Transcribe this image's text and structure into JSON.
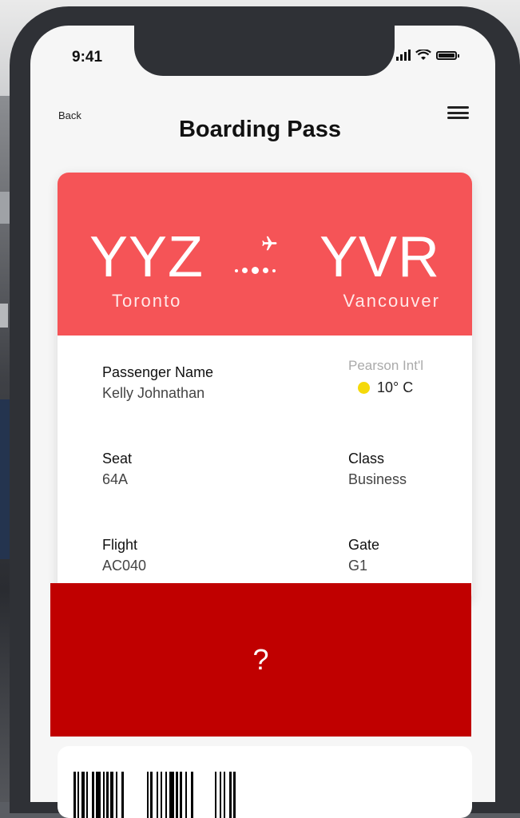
{
  "status_bar": {
    "time": "9:41"
  },
  "nav": {
    "back_label": "Back",
    "title": "Boarding Pass"
  },
  "flight_route": {
    "from_code": "YYZ",
    "from_city": "Toronto",
    "to_code": "YVR",
    "to_city": "Vancouver"
  },
  "weather": {
    "airport": "Pearson Int'l",
    "temperature": "10° C"
  },
  "details": {
    "passenger_label": "Passenger Name",
    "passenger_value": "Kelly Johnathan",
    "seat_label": "Seat",
    "seat_value": "64A",
    "class_label": "Class",
    "class_value": "Business",
    "flight_label": "Flight",
    "flight_value": "AC040",
    "gate_label": "Gate",
    "gate_value": "G1"
  },
  "redaction": {
    "text": "?"
  },
  "colors": {
    "header_red": "#f55457",
    "redaction_red": "#c00000",
    "sun_yellow": "#f5d90a",
    "phone_frame": "#2f3136"
  }
}
